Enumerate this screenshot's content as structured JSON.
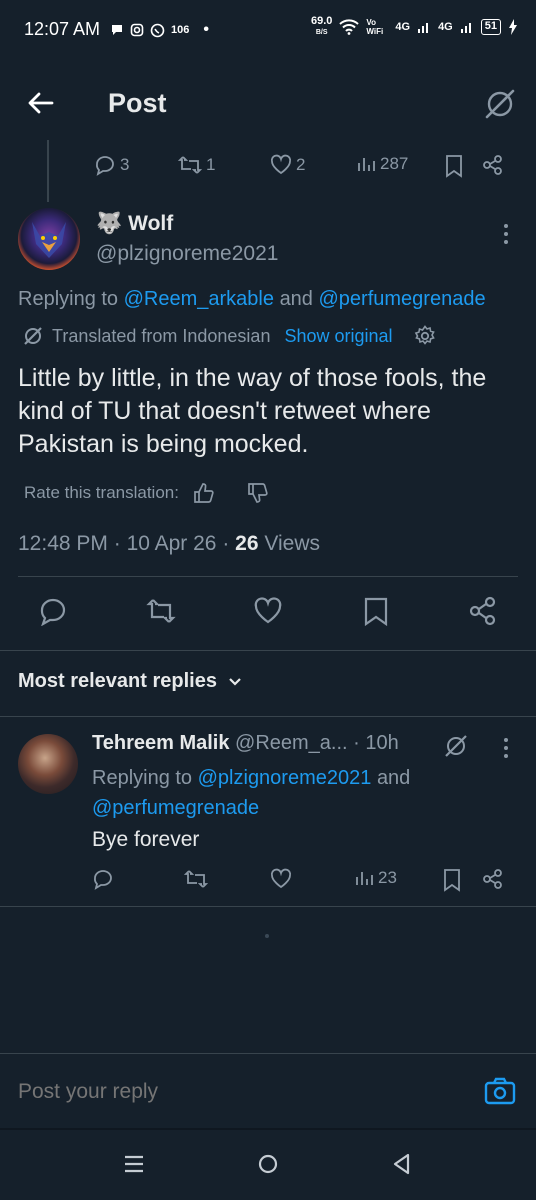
{
  "status_bar": {
    "time": "12:07 AM",
    "notif_count": "106",
    "speed_value": "69.0",
    "speed_unit": "B/S",
    "vowifi": "Vo WiFi",
    "net1": "4G",
    "net2": "4G",
    "battery": "51"
  },
  "header": {
    "title": "Post"
  },
  "parent_actions": {
    "replies": "3",
    "reposts": "1",
    "likes": "2",
    "views": "287"
  },
  "tweet": {
    "emoji": "🐺",
    "display_name": "Wolf",
    "handle": "@plzignoreme2021",
    "replying_prefix": "Replying to",
    "reply_to_1": "@Reem_arkable",
    "reply_and": "and",
    "reply_to_2": "@perfumegrenade",
    "translated_label": "Translated from Indonesian",
    "show_original": "Show original",
    "text": "Little by little, in the way of those fools, the kind of TU that doesn't retweet where Pakistan is being mocked.",
    "rate_label": "Rate this translation:",
    "time": "12:48 PM",
    "dot": "·",
    "date": "10 Apr 26",
    "views_count": "26",
    "views_label": "Views"
  },
  "replies_header": {
    "label": "Most relevant replies"
  },
  "reply": {
    "display_name": "Tehreem Malik",
    "handle": "@Reem_a...",
    "time": "· 10h",
    "replying_prefix": "Replying to",
    "reply_to_1": "@plzignoreme2021",
    "reply_and": "and",
    "reply_to_2": "@perfumegrenade",
    "text": "Bye forever",
    "views": "23"
  },
  "composer": {
    "placeholder": "Post your reply"
  },
  "colors": {
    "background": "#15202b",
    "accent": "#1d9bf0",
    "muted": "#8b98a5",
    "text": "#e7e9ea"
  }
}
